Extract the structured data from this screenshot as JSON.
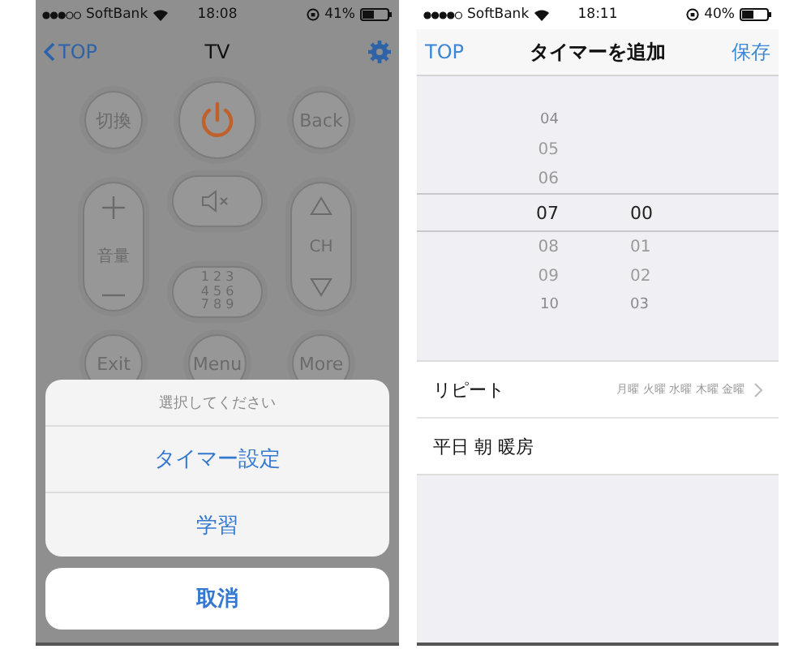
{
  "screens": [
    {
      "kind": "remote",
      "status_bar": {
        "carrier": "SoftBank",
        "time": "18:08",
        "battery": "41%"
      },
      "nav": {
        "back": "TOP",
        "title": "TV"
      },
      "remote": {
        "switch": "切換",
        "back": "Back",
        "volume": "音量",
        "channel": "CH",
        "keypad": [
          "1 2 3",
          "4 5 6",
          "7 8 9"
        ],
        "exit": "Exit",
        "menu": "Menu",
        "more": "More"
      },
      "action_sheet": {
        "title": "選択してください",
        "items": [
          "タイマー設定",
          "学習"
        ],
        "cancel": "取消"
      }
    },
    {
      "kind": "timer",
      "status_bar": {
        "carrier": "SoftBank",
        "time": "18:11",
        "battery": "40%"
      },
      "nav": {
        "back": "TOP",
        "title": "タイマーを追加",
        "save": "保存"
      },
      "picker": {
        "rows": [
          {
            "hour": "04",
            "selected": false
          },
          {
            "hour": "05",
            "selected": false
          },
          {
            "hour": "06",
            "selected": false
          },
          {
            "hour": "07",
            "minute": "00",
            "selected": true
          },
          {
            "hour": "08",
            "minute": "01",
            "selected": false
          },
          {
            "hour": "09",
            "minute": "02",
            "selected": false
          },
          {
            "hour": "10",
            "minute": "03",
            "selected": false
          }
        ]
      },
      "settings": [
        {
          "label": "リピート",
          "value": "月曜 火曜 水曜 木曜 金曜"
        },
        {
          "label": "平日 朝 暖房"
        }
      ]
    }
  ]
}
